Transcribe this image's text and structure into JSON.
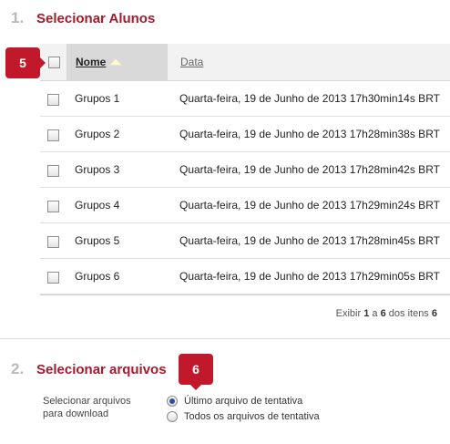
{
  "section1": {
    "number": "1.",
    "title": "Selecionar Alunos"
  },
  "badge5": "5",
  "table": {
    "col_nome": "Nome",
    "col_data": "Data",
    "rows": [
      {
        "name": "Grupos 1",
        "date": "Quarta-feira, 19 de Junho de 2013 17h30min14s BRT"
      },
      {
        "name": "Grupos 2",
        "date": "Quarta-feira, 19 de Junho de 2013 17h28min38s BRT"
      },
      {
        "name": "Grupos 3",
        "date": "Quarta-feira, 19 de Junho de 2013 17h28min42s BRT"
      },
      {
        "name": "Grupos 4",
        "date": "Quarta-feira, 19 de Junho de 2013 17h29min24s BRT"
      },
      {
        "name": "Grupos 5",
        "date": "Quarta-feira, 19 de Junho de 2013 17h28min45s BRT"
      },
      {
        "name": "Grupos 6",
        "date": "Quarta-feira, 19 de Junho de 2013 17h29min05s BRT"
      }
    ],
    "pager": {
      "prefix": "Exibir",
      "from": "1",
      "sep": "a",
      "to": "6",
      "middle": "dos itens",
      "total": "6"
    }
  },
  "section2": {
    "number": "2.",
    "title": "Selecionar arquivos"
  },
  "badge6": "6",
  "download": {
    "label": "Selecionar arquivos para download",
    "options": [
      {
        "label": "Último arquivo de tentativa",
        "selected": true
      },
      {
        "label": "Todos os arquivos de tentativa",
        "selected": false
      }
    ]
  },
  "colors": {
    "accent": "#a6192e",
    "badge": "#c2182c",
    "step_number": "#b9b9b9"
  }
}
